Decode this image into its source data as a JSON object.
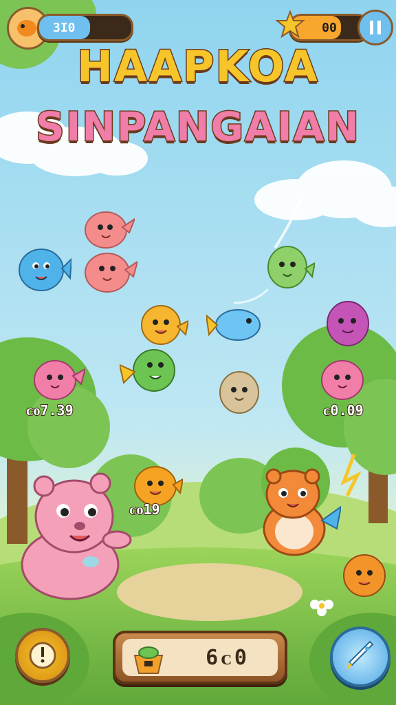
{
  "hud": {
    "coins_value": "3I0",
    "coins_fill_fraction": 0.55,
    "stars_value": "00",
    "stars_fill_fraction": 0.65
  },
  "title": {
    "line1": "HAAPKOA",
    "line2": "SINPANGAIAN"
  },
  "critters": [
    {
      "name": "pink-bird-top",
      "color": "#f48c8c",
      "score": ""
    },
    {
      "name": "blue-fish-left",
      "color": "#4fb3ea",
      "score": ""
    },
    {
      "name": "pink-bird-middle",
      "color": "#f48c8c",
      "score": ""
    },
    {
      "name": "green-bird-right",
      "color": "#8fd06a",
      "score": ""
    },
    {
      "name": "yellow-chick",
      "color": "#f7b62f",
      "score": ""
    },
    {
      "name": "blue-fish-center",
      "color": "#6ec4f2",
      "score": ""
    },
    {
      "name": "purple-blob-right",
      "color": "#c454b6",
      "score": ""
    },
    {
      "name": "green-fish",
      "color": "#6cc453",
      "score": ""
    },
    {
      "name": "pink-bird-left-tree",
      "color": "#f07ea8",
      "score": "ᴄᴏ7.39"
    },
    {
      "name": "beige-bird",
      "color": "#d8c39a",
      "score": ""
    },
    {
      "name": "pink-bird-right-tree",
      "color": "#f07ea8",
      "score": "ᴄ0.09"
    },
    {
      "name": "orange-chick",
      "color": "#f6a324",
      "score": "ᴄᴏ19"
    },
    {
      "name": "orange-fish-bottom",
      "color": "#f2942a",
      "score": ""
    }
  ],
  "score_labels": {
    "left_tree": "ᴄᴏ7.39",
    "right_tree": "ᴄ0.09",
    "orange_chick": "ᴄᴏ19"
  },
  "bottom": {
    "score": "6ᴄ0"
  },
  "colors": {
    "sky_top": "#8fd4ef",
    "grass": "#7bc24a",
    "panel_brown": "#8e5426"
  },
  "icons": {
    "top_left": "goldfish-icon",
    "top_right_star": "star-icon",
    "pause": "pause-icon",
    "bottom_left": "alarm-clock-icon",
    "bottom_right": "rocket-icon",
    "bottom_basket": "basket-icon"
  }
}
